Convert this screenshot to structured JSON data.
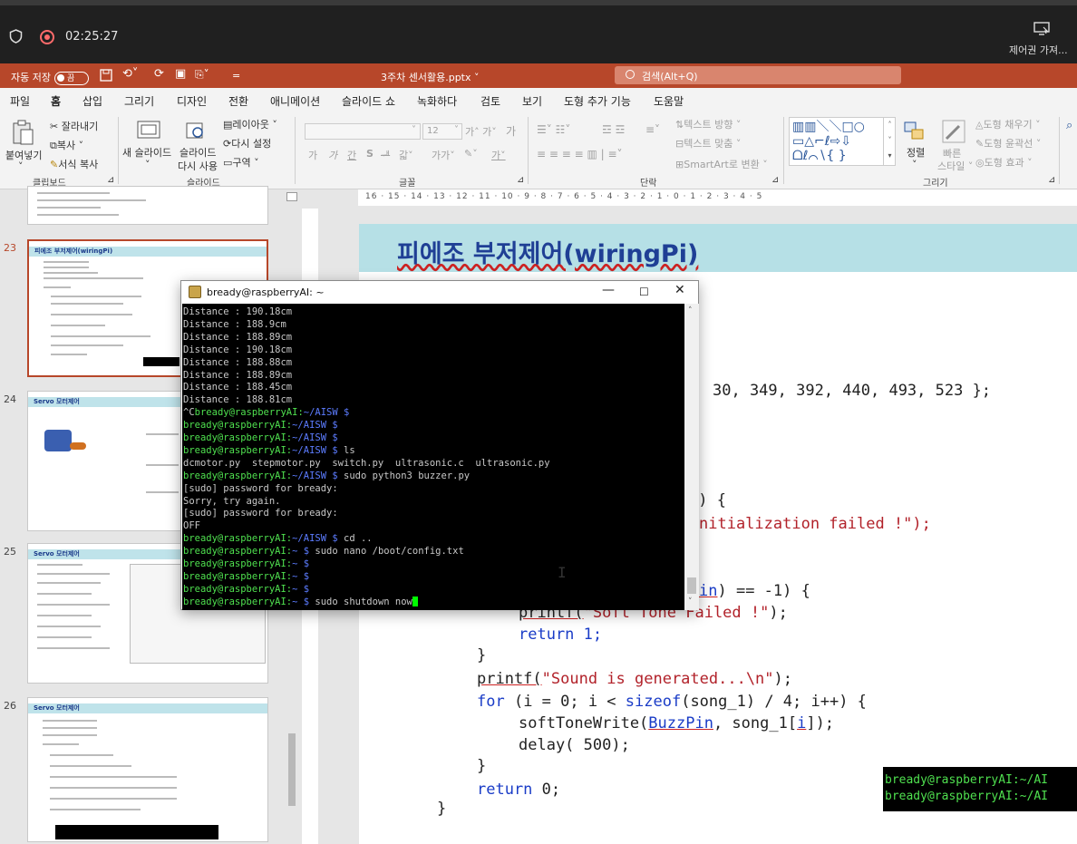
{
  "recorder": {
    "time": "02:25:27",
    "control_label": "제어권 가져..."
  },
  "app": {
    "autosave_label": "자동 저장",
    "autosave_state": "끔",
    "file_name": "3주차 센서활용.pptx",
    "search_placeholder": "검색(Alt+Q)",
    "menu_tabs": [
      "파일",
      "홈",
      "삽입",
      "그리기",
      "디자인",
      "전환",
      "애니메이션",
      "슬라이드 쇼",
      "녹화하다",
      "검토",
      "보기",
      "도형 추가 기능",
      "도움말"
    ],
    "active_tab": "홈"
  },
  "ribbon": {
    "paste": "붙여넣기",
    "cut": "잘라내기",
    "copy": "복사",
    "format_painter": "서식 복사",
    "new_slide": "새 슬라이드",
    "reuse_slide_1": "슬라이드",
    "reuse_slide_2": "다시 사용",
    "layout": "레이아웃",
    "reset": "다시 설정",
    "section": "구역",
    "font_size": "12",
    "text_direction": "텍스트 방향",
    "align_text": "텍스트 맞춤",
    "smartart": "SmartArt로 변환",
    "arrange": "정렬",
    "quick_styles_1": "빠른",
    "quick_styles_2": "스타일",
    "shape_fill": "도형 채우기",
    "shape_outline": "도형 윤곽선",
    "shape_effects": "도형 효과",
    "groups": {
      "clipboard": "클립보드",
      "slides": "슬라이드",
      "font": "글꼴",
      "paragraph": "단락",
      "drawing": "그리기"
    }
  },
  "thumbnails": [
    {
      "num": "23",
      "title": "피에조 부저제어(wiringPi)"
    },
    {
      "num": "24",
      "title": "Servo 모터제어"
    },
    {
      "num": "25",
      "title": "Servo 모터제어"
    },
    {
      "num": "26",
      "title": "Servo 모터제어"
    }
  ],
  "ruler_labels": "16 · 15 · 14 · 13 · 12 · 11 · 10 · 9 · 8 · 7 · 6 · 5 · 4 · 3 · 2 · 1 · 0 · 1 · 2 · 3 · 4 · 5",
  "slide": {
    "title": "피에조 부저제어(wiringPi)",
    "code": {
      "l1": "30, 349, 392, 440, 493, 523 };",
      "l2": "1) {",
      "l3": "nitialization failed !\");",
      "l4a": "in",
      "l4b": ") == -1) {",
      "l5a": "printf(",
      "l5b": "\"Soft Tone Failed !\"",
      "l5c": ");",
      "l6": "return 1;",
      "l7": "}",
      "l8a": "printf(",
      "l8b": "\"Sound is generated...\\n\"",
      "l8c": ");",
      "l9a": "for",
      "l9b": " (i = 0; i < ",
      "l9c": "sizeof",
      "l9d": "(song_1) / 4; i++) {",
      "l10a": "softToneWrite(",
      "l10b": "BuzzPin",
      "l10c": ", song_1[",
      "l10d": "i",
      "l10e": "]);",
      "l11": "delay( 500);",
      "l12": "}",
      "l13a": "return",
      "l13b": " 0;",
      "l14": "}"
    }
  },
  "terminal": {
    "title": "bready@raspberryAI: ~",
    "prompt_user": "bready@raspberryAI",
    "lines": [
      {
        "t": "out",
        "text": "Distance : 190.18cm"
      },
      {
        "t": "out",
        "text": "Distance : 188.9cm"
      },
      {
        "t": "out",
        "text": "Distance : 188.89cm"
      },
      {
        "t": "out",
        "text": "Distance : 190.18cm"
      },
      {
        "t": "out",
        "text": "Distance : 188.88cm"
      },
      {
        "t": "out",
        "text": "Distance : 188.89cm"
      },
      {
        "t": "out",
        "text": "Distance : 188.45cm"
      },
      {
        "t": "out",
        "text": "Distance : 188.81cm"
      },
      {
        "t": "prompt",
        "pre": "^C",
        "path": "~/AISW",
        "cmd": ""
      },
      {
        "t": "prompt",
        "pre": "",
        "path": "~/AISW",
        "cmd": ""
      },
      {
        "t": "prompt",
        "pre": "",
        "path": "~/AISW",
        "cmd": ""
      },
      {
        "t": "prompt",
        "pre": "",
        "path": "~/AISW",
        "cmd": "ls"
      },
      {
        "t": "out",
        "text": "dcmotor.py  stepmotor.py  switch.py  ultrasonic.c  ultrasonic.py"
      },
      {
        "t": "prompt",
        "pre": "",
        "path": "~/AISW",
        "cmd": "sudo python3 buzzer.py"
      },
      {
        "t": "out",
        "text": "[sudo] password for bready:"
      },
      {
        "t": "out",
        "text": "Sorry, try again."
      },
      {
        "t": "out",
        "text": "[sudo] password for bready:"
      },
      {
        "t": "out",
        "text": "OFF"
      },
      {
        "t": "prompt",
        "pre": "",
        "path": "~/AISW",
        "cmd": "cd .."
      },
      {
        "t": "prompt",
        "pre": "",
        "path": "~",
        "cmd": "sudo nano /boot/config.txt"
      },
      {
        "t": "prompt",
        "pre": "",
        "path": "~",
        "cmd": ""
      },
      {
        "t": "prompt",
        "pre": "",
        "path": "~",
        "cmd": ""
      },
      {
        "t": "prompt",
        "pre": "",
        "path": "~",
        "cmd": ""
      },
      {
        "t": "prompt",
        "pre": "",
        "path": "~",
        "cmd": "sudo shutdown now",
        "cursor": true
      }
    ]
  },
  "fragment": {
    "line1": "bready@raspberryAI:~/AI",
    "line2": "bready@raspberryAI:~/AI"
  }
}
